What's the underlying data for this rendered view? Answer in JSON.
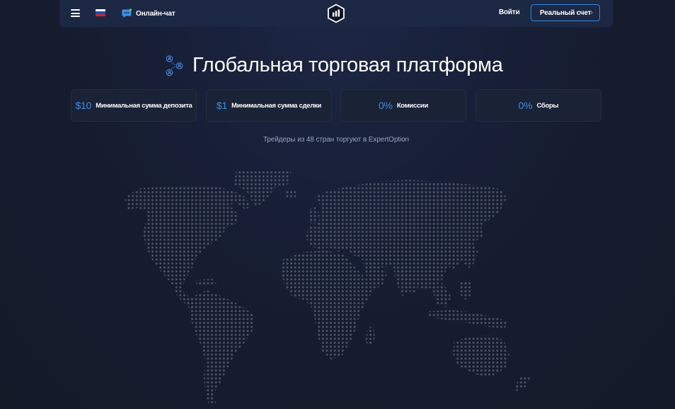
{
  "header": {
    "menu_icon": "hamburger-icon",
    "language_flag": "russia-flag",
    "chat_label": "Онлайн-чат",
    "chat_icon": "chat-bubble-icon",
    "logo_icon": "expertoption-hexagon-logo",
    "login_label": "Войти",
    "real_account_label": "Реальный счет",
    "real_account_chevron": "›",
    "accent_color": "#2f86e0"
  },
  "hero": {
    "icon": "people-network-icon",
    "title": "Глобальная торговая платформа"
  },
  "stats": [
    {
      "value": "$10",
      "label": "Минимальная сумма депозита"
    },
    {
      "value": "$1",
      "label": "Минимальная сумма сделки"
    },
    {
      "value": "0%",
      "label": "Комиссии"
    },
    {
      "value": "0%",
      "label": "Сборы"
    }
  ],
  "subtitle": "Трейдеры из 48 стран торгуют в ExpertOption",
  "map": {
    "style": "dotted-world-map",
    "dot_color": "#4a5264"
  }
}
